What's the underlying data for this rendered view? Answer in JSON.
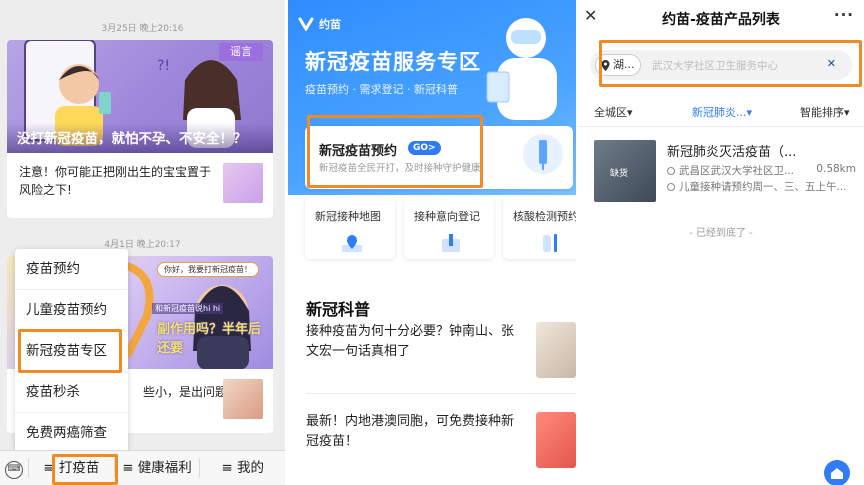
{
  "feed": {
    "timestamp1": "3月25日 晚上20:16",
    "card1": {
      "badge": "谣言",
      "headline": "没打新冠疫苗，就怕不孕、不安全！？",
      "item_text": "注意！你可能正把刚出生的宝宝置于风险之下!"
    },
    "timestamp2": "4月1日 晚上20:17",
    "card2": {
      "bubble": "你好，我要打新冠疫苗！",
      "small_caption": "和新冠疫苗说hi hi",
      "overlay_question": "副作用吗？半年后还要",
      "item_text_tail": "些小，是出问题"
    }
  },
  "menu": {
    "items": [
      "疫苗预约",
      "儿童疫苗预约",
      "新冠疫苗专区",
      "疫苗秒杀",
      "免费两癌筛查"
    ],
    "highlighted_index": 2
  },
  "bottom_bar": {
    "tabs": [
      "≡ 打疫苗",
      "≡ 健康福利",
      "≡ 我的"
    ],
    "tab0_text": "打疫苗"
  },
  "service_page": {
    "app_name": "约苗",
    "title": "新冠疫苗服务专区",
    "subtitle": "疫苗预约 · 需求登记 · 新冠科普",
    "booking": {
      "title": "新冠疫苗预约",
      "go": "GO>",
      "desc": "新冠疫苗全民开打，及时接种守护健康"
    },
    "services": [
      "新冠接种地图",
      "接种意向登记",
      "核酸检测预约"
    ],
    "section_title": "新冠科普",
    "news": [
      "接种疫苗为何十分必要？钟南山、张文宏一句话真相了",
      "最新！内地港澳同胞，可免费接种新冠疫苗！"
    ]
  },
  "product_list": {
    "title": "约苗-疫苗产品列表",
    "more": "···",
    "location": "湖...",
    "search_placeholder": "武汉大学社区卫生服务中心",
    "filters": [
      "全城区▾",
      "新冠肺炎...▾",
      "智能排序▾"
    ],
    "active_filter_index": 1,
    "product": {
      "name": "新冠肺炎灭活疫苗（...",
      "badge": "缺货",
      "address": "武昌区武汉大学社区卫...",
      "distance": "0.58km",
      "schedule": "儿童接种请预约周一、三、五上午..."
    },
    "end_text": "- 已经到底了 -"
  },
  "colors": {
    "highlight_orange": "#f08a24",
    "brand_blue": "#2f7cf6",
    "feed_bg": "#ededed"
  }
}
